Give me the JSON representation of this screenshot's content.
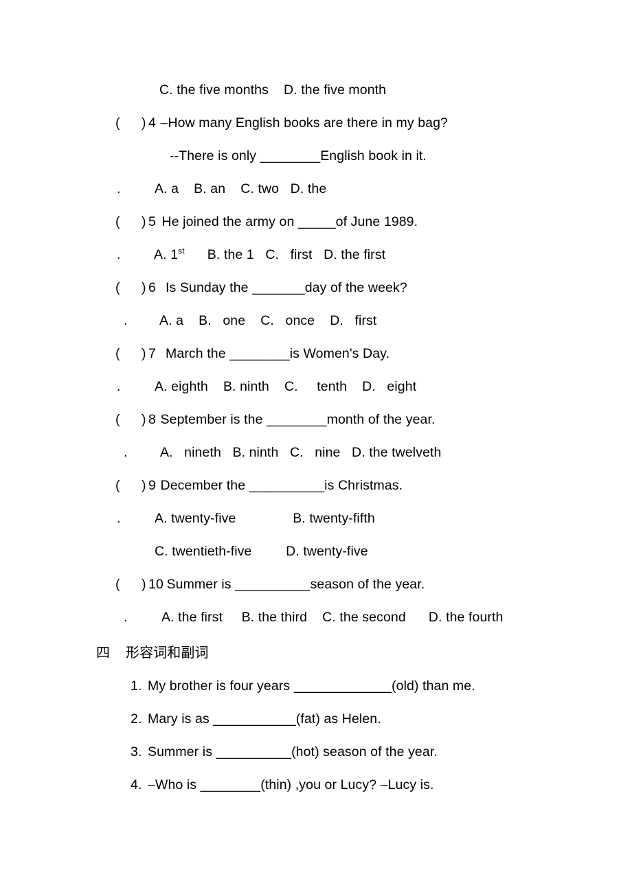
{
  "document": {
    "type": "english-grammar-worksheet",
    "page_background": "#ffffff",
    "text_color": "#000000"
  },
  "continued_options": {
    "marker": "",
    "text": "C. the five months    D. the five month"
  },
  "questions": [
    {
      "paren": "(",
      "close": ")",
      "number": "4",
      "stem": " –How many English books are there in my bag?",
      "stem_cont_marker": "",
      "stem_cont": "--There is only ",
      "stem_cont_blank": "________",
      "stem_cont_tail": "English book in it.",
      "options_marker": ".",
      "options": "A. a    B. an    C. two   D. the"
    },
    {
      "paren": "(",
      "close": ")",
      "number": "5",
      "stem": " He joined the army on ",
      "stem_blank": "_____",
      "stem_tail": "of June 1989.",
      "options_marker": ".",
      "options_a": "A. 1",
      "options_a_sup": "st",
      "options_rest": "      B. the 1   C.   first   D. the first"
    },
    {
      "paren": "(",
      "close": ")",
      "number": "6",
      "stem": "  Is Sunday the ",
      "stem_blank": "_______",
      "stem_tail": "day of the week?",
      "options_marker": ".",
      "options": "A. a    B.   one    C.   once    D.   first"
    },
    {
      "paren": "(",
      "close": ")",
      "number": "7",
      "stem": "  March the ",
      "stem_blank": "________",
      "stem_tail": "is Women's Day.",
      "options_marker": ".",
      "options": "A. eighth    B. ninth    C.     tenth    D.   eight"
    },
    {
      "paren": "(",
      "close": ")",
      "number": "8",
      "stem": " September is the ",
      "stem_blank": "________",
      "stem_tail": "month of the year.",
      "options_marker": ".",
      "options": "A.   nineth   B. ninth   C.   nine   D. the twelveth"
    },
    {
      "paren": "(",
      "close": ")",
      "number": "9",
      "stem": " December the ",
      "stem_blank": "__________",
      "stem_tail": "is Christmas.",
      "options_marker": ".",
      "options_row1": "A. twenty-five               B. twenty-fifth",
      "options_row2": "C. twentieth-five         D. twenty-five"
    },
    {
      "paren": "(",
      "close": ")",
      "number": "10",
      "stem": " Summer is ",
      "stem_blank": "__________",
      "stem_tail": "season of the year.",
      "options_marker": ".",
      "options": "A. the first     B. the third    C. the second      D. the fourth"
    }
  ],
  "section": {
    "number": "四",
    "title": "形容词和副词"
  },
  "fill_in_items": [
    {
      "number": "1.",
      "pre": "My brother is four years ",
      "blank": "_____________",
      "post": "(old) than me."
    },
    {
      "number": "2.",
      "pre": "Mary is as ",
      "blank": "___________",
      "post": "(fat) as Helen."
    },
    {
      "number": "3.",
      "pre": "Summer is ",
      "blank": "__________",
      "post": "(hot) season of the year."
    },
    {
      "number": "4.",
      "pre": "–Who is ",
      "blank": "________",
      "post": "(thin) ,you or Lucy? –Lucy is."
    }
  ]
}
